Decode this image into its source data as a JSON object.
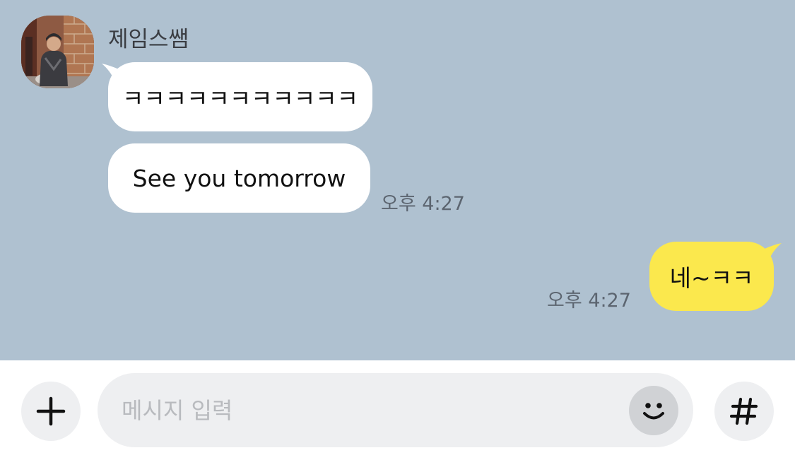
{
  "chat": {
    "background_color": "#afc1d0",
    "sender": {
      "name": "제임스쌤",
      "avatar": "profile-photo"
    },
    "messages": [
      {
        "direction": "incoming",
        "text": "ㅋㅋㅋㅋㅋㅋㅋㅋㅋㅋㅋ"
      },
      {
        "direction": "incoming",
        "text": "See you tomorrow",
        "time": "오후 4:27"
      },
      {
        "direction": "outgoing",
        "text": "네~ㅋㅋ",
        "time": "오후 4:27"
      }
    ],
    "incoming_bubble_color": "#ffffff",
    "outgoing_bubble_color": "#fbe84d"
  },
  "input_bar": {
    "placeholder": "메시지 입력",
    "value": "",
    "plus_icon": "plus-icon",
    "emoji_icon": "smiley-icon",
    "hash_icon": "hash-icon"
  }
}
